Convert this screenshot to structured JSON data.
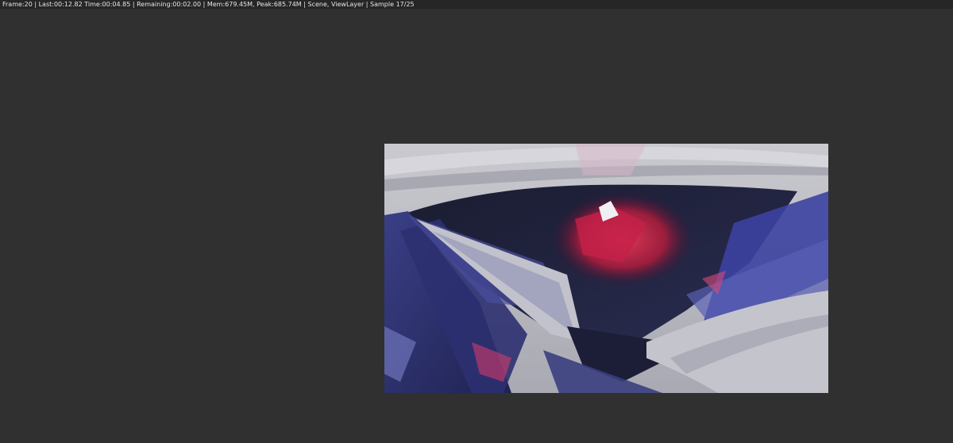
{
  "status_bar": {
    "text": "Frame:20 | Last:00:12.82 Time:00:04.85 | Remaining:00:02.00 | Mem:679.45M, Peak:685.74M | Scene, ViewLayer | Sample 17/25"
  },
  "render": {
    "image_name": "gemstone-render-icon"
  },
  "colors": {
    "background": "#303030",
    "status_bar": "#262626",
    "status_text": "#e6e6e6"
  }
}
